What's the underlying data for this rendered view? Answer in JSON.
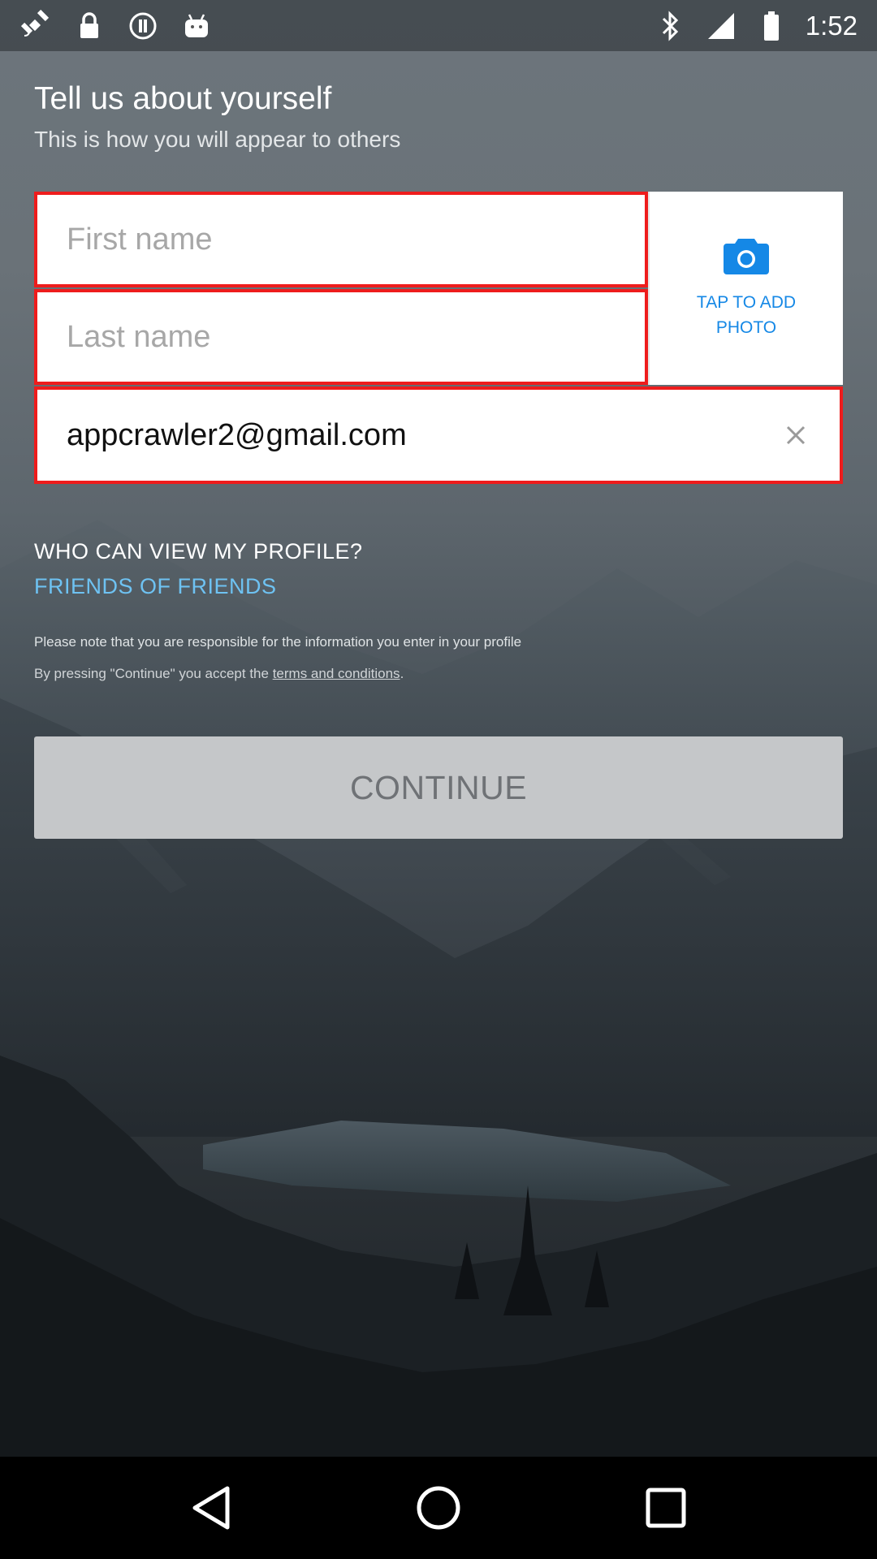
{
  "status_bar": {
    "time": "1:52",
    "icons": [
      "satellite-icon",
      "lock-icon",
      "info-circle-icon",
      "android-icon",
      "bluetooth-icon",
      "signal-icon",
      "battery-icon"
    ]
  },
  "header": {
    "title": "Tell us about yourself",
    "subtitle": "This is how you will appear to others"
  },
  "form": {
    "first_name": {
      "value": "",
      "placeholder": "First name"
    },
    "last_name": {
      "value": "",
      "placeholder": "Last name"
    },
    "email": {
      "value": "appcrawler2@gmail.com",
      "placeholder": ""
    },
    "photo_label": "TAP TO ADD PHOTO",
    "error_border_color": "#ee1c1c"
  },
  "privacy": {
    "label": "WHO CAN VIEW MY PROFILE?",
    "value": "FRIENDS OF FRIENDS",
    "value_color": "#6ec2f2"
  },
  "legal": {
    "note": "Please note that you are responsible for the information you enter in your profile",
    "terms_prefix": "By pressing \"Continue\" you accept the ",
    "terms_link": "terms and conditions",
    "terms_suffix": "."
  },
  "continue_label": "CONTINUE",
  "colors": {
    "accent": "#1588e6",
    "button_bg": "#c5c7c9",
    "button_text": "#6f7276"
  },
  "nav": {
    "buttons": [
      "back-icon",
      "home-icon",
      "recents-icon"
    ]
  }
}
